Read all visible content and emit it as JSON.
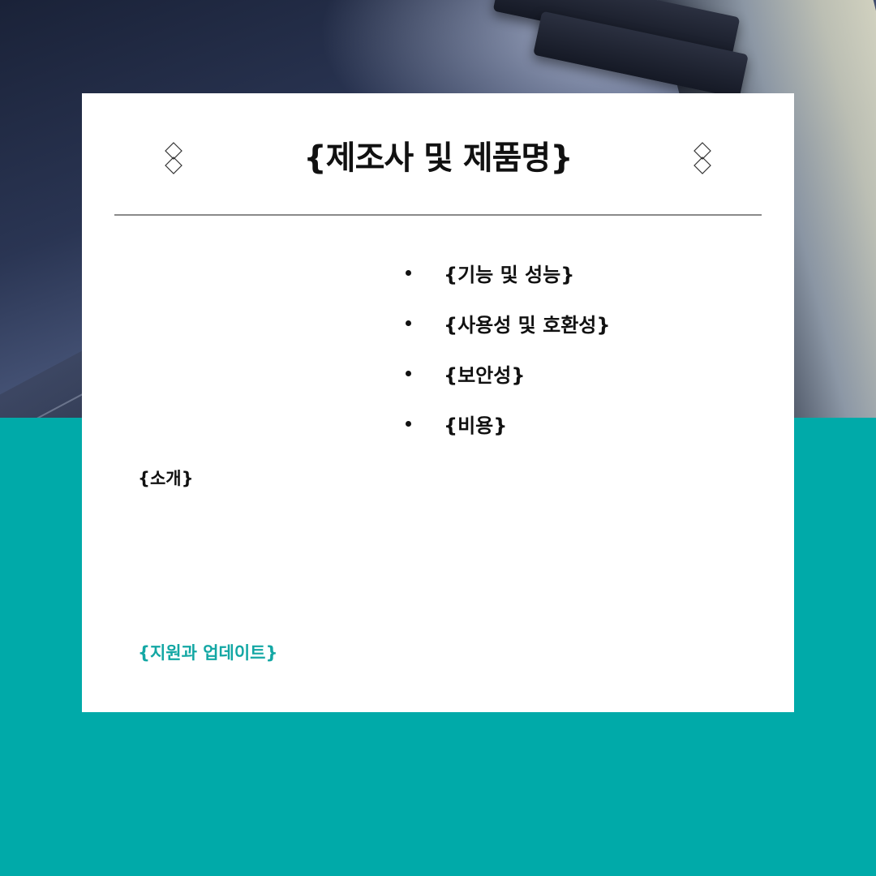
{
  "title": "{제조사 및 제품명}",
  "features": [
    "{기능 및 성능}",
    "{사용성 및 호환성}",
    "{보안성}",
    "{비용}"
  ],
  "intro": "{소개}",
  "support": "{지원과 업데이트}",
  "colors": {
    "accent_teal": "#00aaa9",
    "card": "#ffffff",
    "text": "#111111",
    "divider": "#8a8a8a"
  },
  "icons": {
    "ornament": "double-diamond-icon",
    "bullet": "bullet-dot"
  }
}
